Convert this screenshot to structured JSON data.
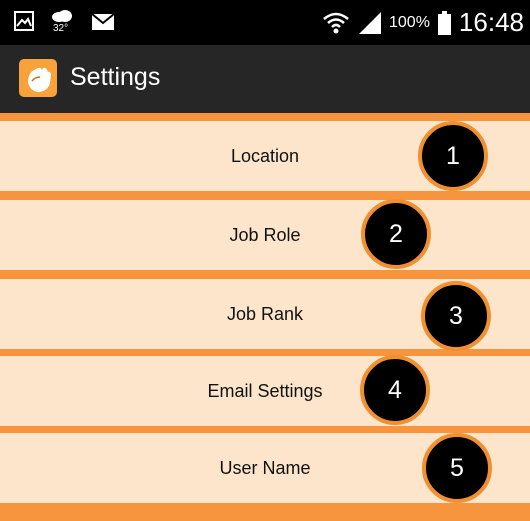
{
  "status_bar": {
    "temperature": "32°",
    "battery_percent": "100%",
    "time": "16:48"
  },
  "action_bar": {
    "title": "Settings",
    "app_icon": "hand-icon"
  },
  "settings": [
    {
      "label": "Location"
    },
    {
      "label": "Job Role"
    },
    {
      "label": "Job Rank"
    },
    {
      "label": "Email Settings"
    },
    {
      "label": "User Name"
    }
  ],
  "markers": [
    "1",
    "2",
    "3",
    "4",
    "5"
  ],
  "colors": {
    "row_bg": "#fde5cc",
    "separator": "#f7953f",
    "action_bar": "#262626",
    "marker_border": "#f09030"
  }
}
